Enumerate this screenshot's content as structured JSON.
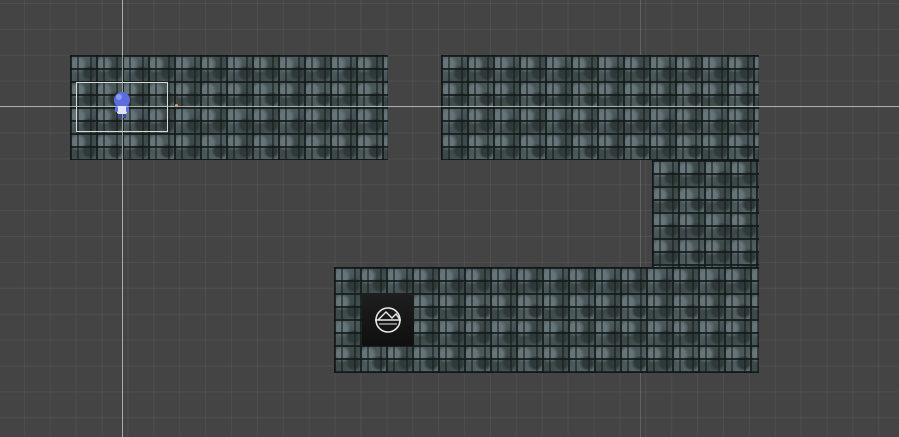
{
  "scene": {
    "background_color": "#444444",
    "grid_color": "rgba(255,255,255,0.055)",
    "tile_color": "#4b5858",
    "selection_color": "#d8d8d8",
    "player_color": "#5b6de0"
  },
  "icons": {
    "player": "player-sprite-icon",
    "camera": "camera-gizmo-icon",
    "pivot": "pivot-icon"
  }
}
